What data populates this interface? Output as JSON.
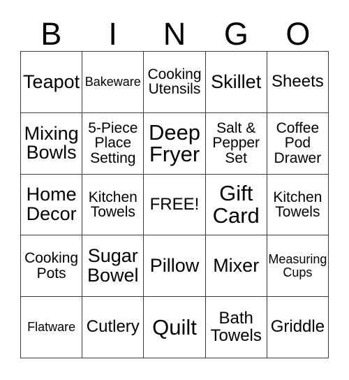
{
  "card": {
    "type": "bingo-card",
    "columns": 5,
    "rows": 5,
    "background_color": "#ffffff",
    "text_color": "#000000",
    "border_color": "#3a3a3a",
    "header": {
      "letters": [
        "B",
        "I",
        "N",
        "G",
        "O"
      ]
    },
    "cells": [
      [
        {
          "text": "Teapot",
          "fit": "xl",
          "free": false
        },
        {
          "text": "Bakeware",
          "fit": "sm",
          "free": false
        },
        {
          "text": "Cooking\nUtensils",
          "fit": "md",
          "free": false
        },
        {
          "text": "Skillet",
          "fit": "xl",
          "free": false
        },
        {
          "text": "Sheets",
          "fit": "lg",
          "free": false
        }
      ],
      [
        {
          "text": "Mixing\nBowls",
          "fit": "xl",
          "free": false
        },
        {
          "text": "5-Piece\nPlace\nSetting",
          "fit": "md",
          "free": false
        },
        {
          "text": "Deep\nFryer",
          "fit": "xxl",
          "free": false
        },
        {
          "text": "Salt &\nPepper\nSet",
          "fit": "md",
          "free": false
        },
        {
          "text": "Coffee\nPod\nDrawer",
          "fit": "md",
          "free": false
        }
      ],
      [
        {
          "text": "Home\nDecor",
          "fit": "xl",
          "free": false
        },
        {
          "text": "Kitchen\nTowels",
          "fit": "md",
          "free": false
        },
        {
          "text": "FREE!",
          "fit": "lg",
          "free": true
        },
        {
          "text": "Gift\nCard",
          "fit": "xxl",
          "free": false
        },
        {
          "text": "Kitchen\nTowels",
          "fit": "md",
          "free": false
        }
      ],
      [
        {
          "text": "Cooking\nPots",
          "fit": "md",
          "free": false
        },
        {
          "text": "Sugar\nBowel",
          "fit": "xl",
          "free": false
        },
        {
          "text": "Pillow",
          "fit": "xl",
          "free": false
        },
        {
          "text": "Mixer",
          "fit": "xl",
          "free": false
        },
        {
          "text": "Measuring\nCups",
          "fit": "sm",
          "free": false
        }
      ],
      [
        {
          "text": "Flatware",
          "fit": "sm",
          "free": false
        },
        {
          "text": "Cutlery",
          "fit": "lg",
          "free": false
        },
        {
          "text": "Quilt",
          "fit": "xxl",
          "free": false
        },
        {
          "text": "Bath\nTowels",
          "fit": "lg",
          "free": false
        },
        {
          "text": "Griddle",
          "fit": "lg",
          "free": false
        }
      ]
    ]
  }
}
